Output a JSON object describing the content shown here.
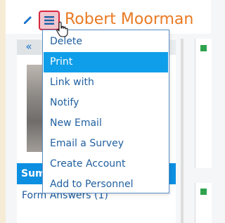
{
  "header": {
    "person_name": "Robert Moorman",
    "icons": {
      "edit": "pencil-icon",
      "menu": "hamburger-icon",
      "cursor": "hand-pointer-icon"
    }
  },
  "colors": {
    "accent_name": "#e97a23",
    "menu_active": "#0f9ee9",
    "summary_tab": "#0d8fe1",
    "link_text": "#1f5f9f",
    "status_green": "#2fa24d"
  },
  "left_panel": {
    "back_label": "«",
    "summary_tab_label": "Sum",
    "form_answers_label": "Form Answers (1)"
  },
  "dropdown_menu": {
    "items": [
      {
        "label": "Delete"
      },
      {
        "label": "Print"
      },
      {
        "label": "Link with"
      },
      {
        "label": "Notify"
      },
      {
        "label": "New Email"
      },
      {
        "label": "Email a Survey"
      },
      {
        "label": "Create Account"
      },
      {
        "label": "Add to Personnel"
      }
    ],
    "active_item": "Print"
  }
}
